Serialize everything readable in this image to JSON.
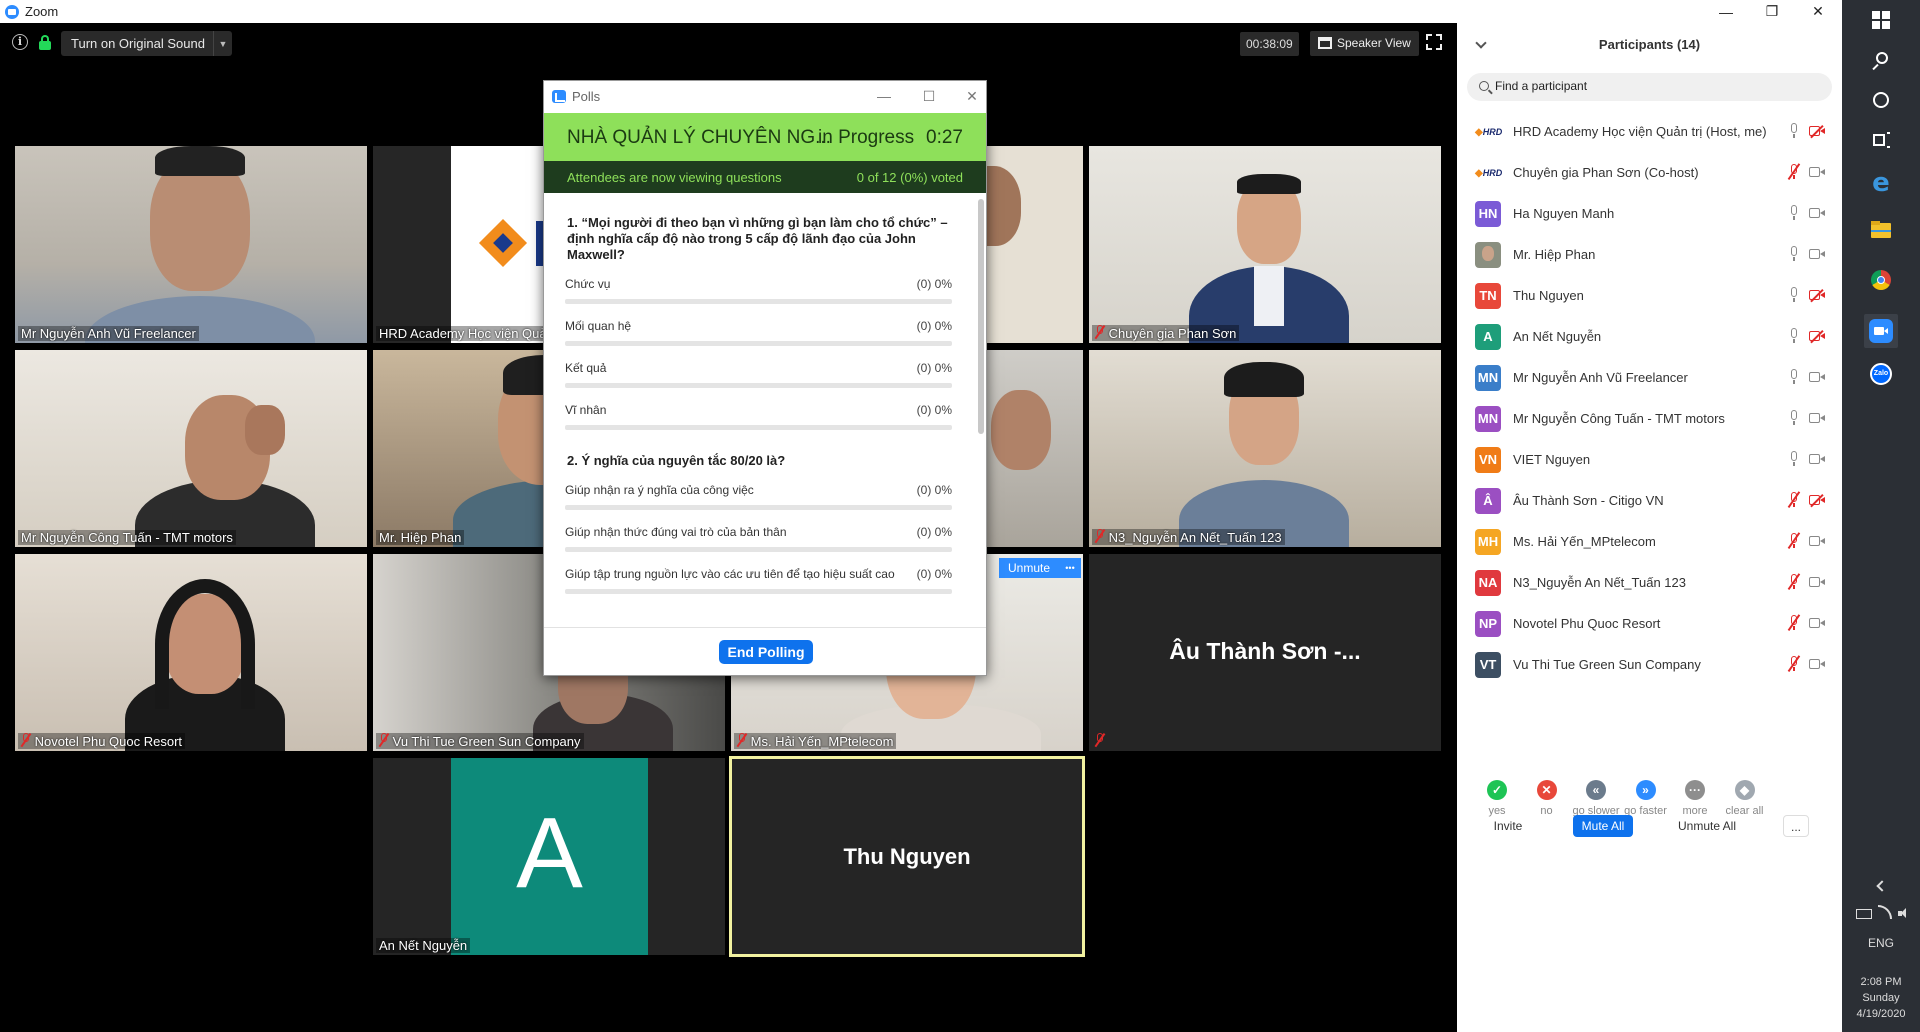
{
  "window": {
    "title": "Zoom"
  },
  "toolbar": {
    "original_sound": "Turn on Original Sound",
    "timer": "00:38:09",
    "speaker_view": "Speaker View"
  },
  "tiles": [
    {
      "name": "Mr Nguyễn Anh Vũ Freelancer"
    },
    {
      "name": "HRD Academy Học viện Quả"
    },
    {
      "name": "Chuyên gia Phan Sơn"
    },
    {
      "name": "Mr Nguyễn Công Tuấn - TMT motors"
    },
    {
      "name": "Mr. Hiệp Phan"
    },
    {
      "name": "N3_Nguyễn An Nết_Tuấn 123"
    },
    {
      "name": "Novotel Phu Quoc Resort"
    },
    {
      "name": "Vu Thi Tue Green Sun Company"
    },
    {
      "name": "Ms. Hải Yến_MPtelecom"
    },
    {
      "name": "Âu Thành Sơn -..."
    },
    {
      "name": "An Nết Nguyễn",
      "letter": "A"
    },
    {
      "name": "Thu Nguyen"
    }
  ],
  "tile_controls": {
    "unmute": "Unmute",
    "more": "•••"
  },
  "polls": {
    "window_title": "Polls",
    "title": "NHÀ QUẢN LÝ CHUYÊN NG...",
    "status": "in Progress",
    "time": "0:27",
    "subheader": "Attendees are now viewing questions",
    "voted": "0 of 12 (0%) voted",
    "questions": [
      {
        "text": "1. “Mọi người đi theo bạn vì những gì bạn làm cho tổ chức” – định nghĩa cấp độ nào trong 5 cấp độ lãnh đạo của John Maxwell?",
        "options": [
          {
            "label": "Chức vụ",
            "value": "(0) 0%",
            "fraction": 0
          },
          {
            "label": "Mối quan hệ",
            "value": "(0) 0%",
            "fraction": 0
          },
          {
            "label": "Kết quả",
            "value": "(0) 0%",
            "fraction": 0
          },
          {
            "label": "Vĩ nhân",
            "value": "(0) 0%",
            "fraction": 0
          }
        ]
      },
      {
        "text": "2. Ý nghĩa của nguyên tắc 80/20 là?",
        "options": [
          {
            "label": "Giúp nhận ra ý nghĩa của công việc",
            "value": "(0) 0%",
            "fraction": 0
          },
          {
            "label": "Giúp nhận thức đúng vai trò của bản thân",
            "value": "(0) 0%",
            "fraction": 0
          },
          {
            "label": "Giúp tập trung nguồn lực vào các ưu tiên để tạo hiệu suất cao",
            "value": "(0) 0%",
            "fraction": 0
          }
        ]
      }
    ],
    "end_button": "End Polling"
  },
  "participants": {
    "title": "Participants (14)",
    "search_placeholder": "Find a participant",
    "list": [
      {
        "initials": "HRD",
        "avatar": "hrd",
        "color": "",
        "name": "HRD Academy Học viện Quản trị (Host, me)",
        "mic": "on",
        "cam": "off"
      },
      {
        "initials": "HRD",
        "avatar": "hrd",
        "color": "",
        "name": "Chuyên gia Phan Sơn (Co-host)",
        "mic": "muted",
        "cam": "on"
      },
      {
        "initials": "HN",
        "avatar": "letter",
        "color": "#7b5bd6",
        "name": "Ha Nguyen Manh",
        "mic": "on",
        "cam": "on"
      },
      {
        "initials": "",
        "avatar": "photo",
        "color": "#8a8f80",
        "name": "Mr. Hiệp Phan",
        "mic": "on",
        "cam": "on"
      },
      {
        "initials": "TN",
        "avatar": "letter",
        "color": "#e8483a",
        "name": "Thu Nguyen",
        "mic": "on",
        "cam": "off"
      },
      {
        "initials": "A",
        "avatar": "letter",
        "color": "#1e9e7a",
        "name": "An Nết Nguyễn",
        "mic": "on",
        "cam": "off"
      },
      {
        "initials": "MN",
        "avatar": "letter",
        "color": "#3a7ec9",
        "name": "Mr Nguyễn Anh Vũ Freelancer",
        "mic": "on",
        "cam": "on"
      },
      {
        "initials": "MN",
        "avatar": "letter",
        "color": "#9b4fc2",
        "name": "Mr Nguyễn Công Tuấn - TMT motors",
        "mic": "on",
        "cam": "on"
      },
      {
        "initials": "VN",
        "avatar": "letter",
        "color": "#f07c17",
        "name": "VIET Nguyen",
        "mic": "on",
        "cam": "on"
      },
      {
        "initials": "Â",
        "avatar": "letter",
        "color": "#9b4fc2",
        "name": "Âu Thành Sơn - Citigo VN",
        "mic": "muted",
        "cam": "off"
      },
      {
        "initials": "MH",
        "avatar": "letter",
        "color": "#f5a623",
        "name": "Ms. Hải Yến_MPtelecom",
        "mic": "muted",
        "cam": "on"
      },
      {
        "initials": "NA",
        "avatar": "letter",
        "color": "#e0393e",
        "name": "N3_Nguyễn An Nết_Tuấn 123",
        "mic": "muted",
        "cam": "on"
      },
      {
        "initials": "NP",
        "avatar": "letter",
        "color": "#9b4fc2",
        "name": "Novotel Phu Quoc Resort",
        "mic": "muted",
        "cam": "on"
      },
      {
        "initials": "VT",
        "avatar": "letter",
        "color": "#3d4f63",
        "name": "Vu Thi Tue Green Sun Company",
        "mic": "muted",
        "cam": "on"
      }
    ],
    "reactions": [
      {
        "label": "yes",
        "glyph": "✓",
        "color": "#1ec455"
      },
      {
        "label": "no",
        "glyph": "✕",
        "color": "#e8483a"
      },
      {
        "label": "go slower",
        "glyph": "«",
        "color": "#6b7b8c"
      },
      {
        "label": "go faster",
        "glyph": "»",
        "color": "#2d8cff"
      },
      {
        "label": "more",
        "glyph": "···",
        "color": "#8e8e8e"
      },
      {
        "label": "clear all",
        "glyph": "◆",
        "color": "#a0a8b0"
      }
    ],
    "buttons": {
      "invite": "Invite",
      "mute_all": "Mute All",
      "unmute_all": "Unmute All",
      "more": "..."
    }
  },
  "taskbar": {
    "language": "ENG",
    "time": "2:08 PM",
    "day": "Sunday",
    "date": "4/19/2020"
  }
}
